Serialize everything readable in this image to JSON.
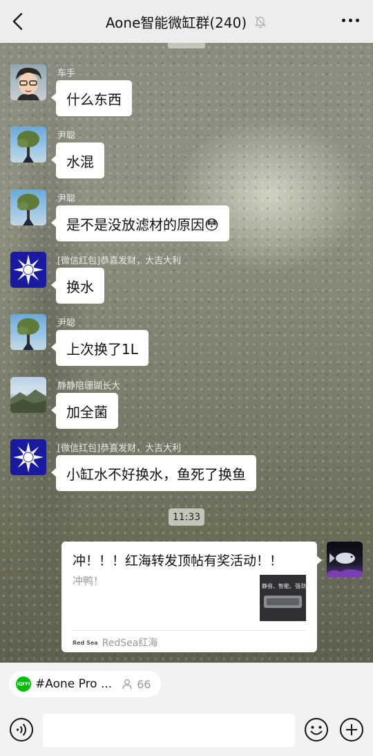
{
  "header": {
    "title": "Aone智能微缸群(240)",
    "back_icon": "chevron-left-icon",
    "mute_icon": "bell-muted-icon",
    "more_icon": "more-dots-icon"
  },
  "messages": [
    {
      "sender": "车手",
      "text": "什么东西",
      "avatar": "avatar-cartoon-driver"
    },
    {
      "sender": "尹聪",
      "text": "水混",
      "avatar": "avatar-tree"
    },
    {
      "sender": "尹聪",
      "text": "是不是没放滤材的原因😳",
      "avatar": "avatar-tree"
    },
    {
      "sender": "[微信红包]恭喜发财，大吉大利",
      "text": "换水",
      "avatar": "avatar-flag"
    },
    {
      "sender": "尹聪",
      "text": "上次换了1L",
      "avatar": "avatar-tree"
    },
    {
      "sender": "静静陪珊瑚长大",
      "text": "加全菌",
      "avatar": "avatar-mountain"
    },
    {
      "sender": "[微信红包]恭喜发财，大吉大利",
      "text": "小缸水不好换水，鱼死了换鱼",
      "avatar": "avatar-flag"
    }
  ],
  "time_divider": "11:33",
  "shared_card": {
    "title": "冲！！！红海转发顶帖有奖活动！！",
    "description": "冲鸭！",
    "thumbnail_text": "静音、智能、强劲",
    "source_logo": "Red Sea",
    "source_name": "RedSea红海",
    "sender_avatar": "avatar-fish"
  },
  "channel_bar": {
    "name": "#Aone Pro ...",
    "viewer_count": "66",
    "app_icon_text": "iQIYI"
  },
  "input_bar": {
    "voice_icon": "voice-icon",
    "emoji_icon": "emoji-icon",
    "plus_icon": "plus-icon"
  },
  "colors": {
    "header_bg": "#ededed",
    "bubble_bg": "#ffffff",
    "bottom_bg": "#f2f2f2",
    "iqiyi_green": "#00be06"
  }
}
